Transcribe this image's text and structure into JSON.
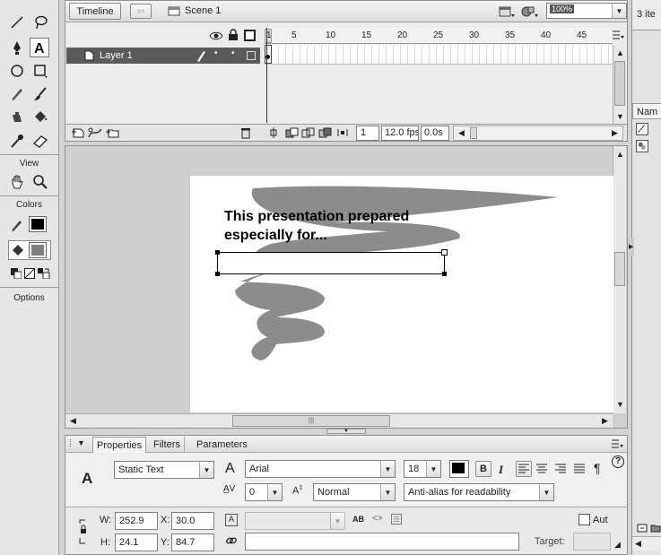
{
  "timeline": {
    "tab_label": "Timeline",
    "scene_label": "Scene 1",
    "zoom_value": "100%",
    "layer_name": "Layer 1",
    "frame_numbers": [
      "1",
      "5",
      "10",
      "15",
      "20",
      "25",
      "30",
      "35",
      "40",
      "45"
    ],
    "current_frame": "1",
    "frame_rate": "12.0 fps",
    "elapsed_time": "0.0s"
  },
  "toolbox": {
    "view_label": "View",
    "colors_label": "Colors",
    "options_label": "Options"
  },
  "stage": {
    "text_line1": "This presentation prepared",
    "text_line2": "especially for..."
  },
  "properties": {
    "tabs": [
      "Properties",
      "Filters",
      "Parameters"
    ],
    "text_type": "Static Text",
    "font": "Arial",
    "font_size": "18",
    "letter_spacing": "0",
    "position_mode": "Normal",
    "anti_alias": "Anti-alias for readability",
    "w_label": "W:",
    "w_value": "252.9",
    "x_label": "X:",
    "x_value": "30.0",
    "h_label": "H:",
    "h_value": "24.1",
    "y_label": "Y:",
    "y_value": "84.7",
    "auto_label": "Aut",
    "target_label": "Target:",
    "bold_label": "B",
    "italic_label": "I",
    "paragraph_symbol": "¶"
  },
  "right_panel": {
    "items_label": "3 ite",
    "name_label": "Nam"
  },
  "colors": {
    "stroke": "#000000",
    "fill": "#808080",
    "scribble": "#8c8c8c",
    "layer_selected": "#5a5a5a"
  }
}
